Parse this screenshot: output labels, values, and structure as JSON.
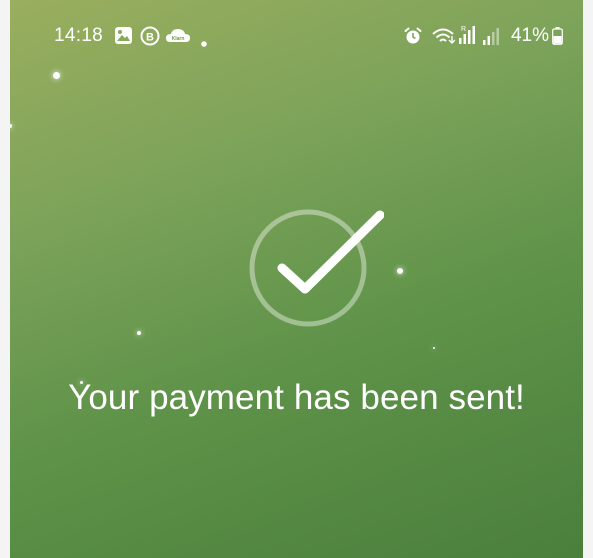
{
  "status_bar": {
    "time": "14:18",
    "battery_percent": "41%",
    "icons": [
      "gallery-icon",
      "b-badge-icon",
      "klarna-cloud-icon",
      "notification-dot-icon",
      "alarm-icon",
      "wifi-icon",
      "signal-r-icon",
      "signal-icon",
      "battery-icon"
    ],
    "klarna_label": "Klarn"
  },
  "confirmation": {
    "message": "Your payment has been sent!",
    "icon": "checkmark-circle-icon"
  },
  "colors": {
    "background_start": "#9aae5e",
    "background_end": "#4a7f3c",
    "foreground": "#ffffff"
  }
}
